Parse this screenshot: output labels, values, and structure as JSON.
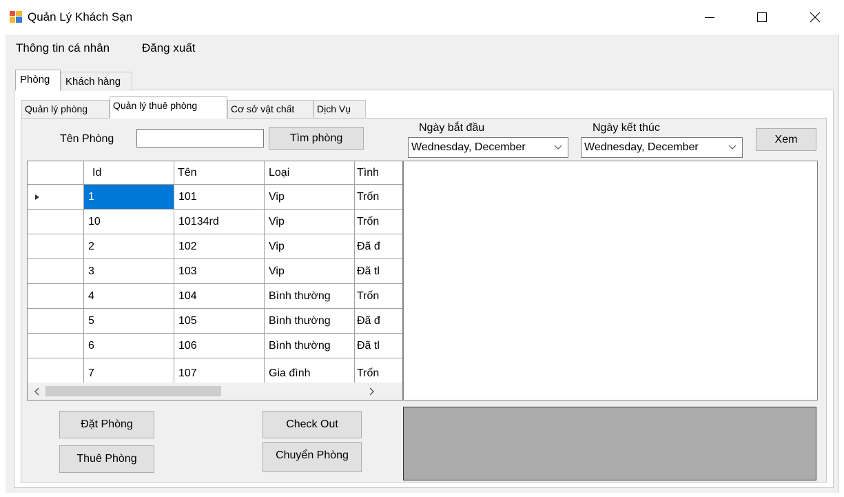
{
  "window": {
    "title": "Quản Lý Khách Sạn"
  },
  "menu": {
    "items": [
      "Thông tin cá nhân",
      "Đăng xuất"
    ]
  },
  "outer_tabs": [
    "Phòng",
    "Khách hàng"
  ],
  "inner_tabs": [
    "Quản lý phòng",
    "Quản lý thuê phòng",
    "Cơ sở vật chất",
    "Dịch Vụ"
  ],
  "search": {
    "label": "Tên Phòng",
    "value": "",
    "button": "Tìm phòng"
  },
  "dates": {
    "start_label": "Ngày bắt đầu",
    "start_value": "Wednesday, December",
    "end_label": "Ngày kết thúc",
    "end_value": "Wednesday, December",
    "view_button": "Xem"
  },
  "grid": {
    "columns": [
      "Id",
      "Tên",
      "Loại",
      "Tình"
    ],
    "rows": [
      [
        "1",
        "101",
        "Vip",
        "Trốn"
      ],
      [
        "10",
        "10134rd",
        "Vip",
        "Trốn"
      ],
      [
        "2",
        "102",
        "Vip",
        "Đã đ"
      ],
      [
        "3",
        "103",
        "Vip",
        "Đã tl"
      ],
      [
        "4",
        "104",
        "Bình thường",
        "Trốn"
      ],
      [
        "5",
        "105",
        "Bình thường",
        "Đã đ"
      ],
      [
        "6",
        "106",
        "Bình thường",
        "Đã tl"
      ],
      [
        "7",
        "107",
        "Gia đình",
        "Trốn"
      ]
    ]
  },
  "buttons": {
    "book": "Đặt Phòng",
    "rent": "Thuê Phòng",
    "checkout": "Check Out",
    "transfer": "Chuyển Phòng"
  }
}
